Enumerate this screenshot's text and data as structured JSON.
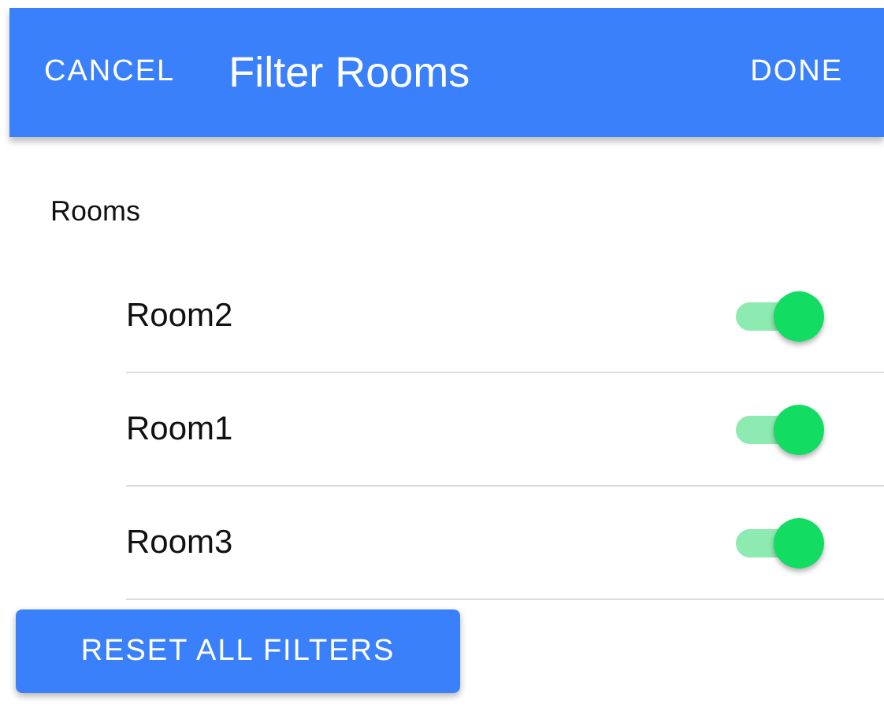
{
  "header": {
    "cancel": "CANCEL",
    "title": "Filter Rooms",
    "done": "DONE"
  },
  "section": "Rooms",
  "rooms": [
    {
      "name": "Room2",
      "on": true
    },
    {
      "name": "Room1",
      "on": true
    },
    {
      "name": "Room3",
      "on": true
    }
  ],
  "reset_button": "RESET ALL FILTERS"
}
